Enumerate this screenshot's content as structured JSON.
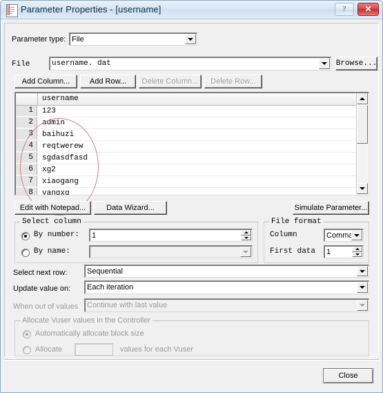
{
  "window": {
    "title": "Parameter Properties - [username]",
    "icon": "document-icon",
    "help_label": "?",
    "close_label": "✕"
  },
  "parameter_type": {
    "label": "Parameter type:",
    "value": "File"
  },
  "file_row": {
    "label": "File",
    "value": "username. dat",
    "browse_label": "Browse..."
  },
  "table_toolbar": {
    "add_column": "Add Column...",
    "add_row": "Add Row...",
    "delete_column": "Delete Column...",
    "delete_row": "Delete Row..."
  },
  "grid": {
    "column_header": "username",
    "rows": [
      {
        "n": "1",
        "value": "123"
      },
      {
        "n": "2",
        "value": "admin"
      },
      {
        "n": "3",
        "value": "baihuzi"
      },
      {
        "n": "4",
        "value": "reqtwerew"
      },
      {
        "n": "5",
        "value": "sgdasdfasd"
      },
      {
        "n": "6",
        "value": "xg2"
      },
      {
        "n": "7",
        "value": "xiaogang"
      },
      {
        "n": "8",
        "value": "yangxg"
      }
    ]
  },
  "actions": {
    "edit_with_notepad": "Edit with Notepad...",
    "data_wizard": "Data Wizard...",
    "simulate_parameter": "Simulate Parameter..."
  },
  "select_column": {
    "caption": "Select column",
    "by_number_label": "By number:",
    "by_number_value": "1",
    "by_number_selected": true,
    "by_name_label": "By name:",
    "by_name_value": "",
    "by_name_selected": false
  },
  "file_format": {
    "caption": "File format",
    "column_label": "Column",
    "column_value": "Comma",
    "first_data_label": "First data",
    "first_data_value": "1"
  },
  "row_options": {
    "select_next_row_label": "Select next row:",
    "select_next_row_value": "Sequential",
    "update_value_on_label": "Update value on:",
    "update_value_on_value": "Each iteration",
    "when_out_of_values_label": "When out of values",
    "when_out_of_values_value": "Continue with last value"
  },
  "allocate": {
    "caption": "Allocate Vuser values in the Controller",
    "auto_label": "Automatically allocate block size",
    "auto_selected": true,
    "manual_label_pre": "Allocate",
    "manual_value": "",
    "manual_label_post": "values for each Vuser",
    "manual_selected": false
  },
  "footer": {
    "close_label": "Close"
  },
  "colors": {
    "titlebar_text": "#0b2a48",
    "close_button": "#c42f2f",
    "annotation": "#d47b86",
    "disabled_text": "#9a9a9a"
  }
}
